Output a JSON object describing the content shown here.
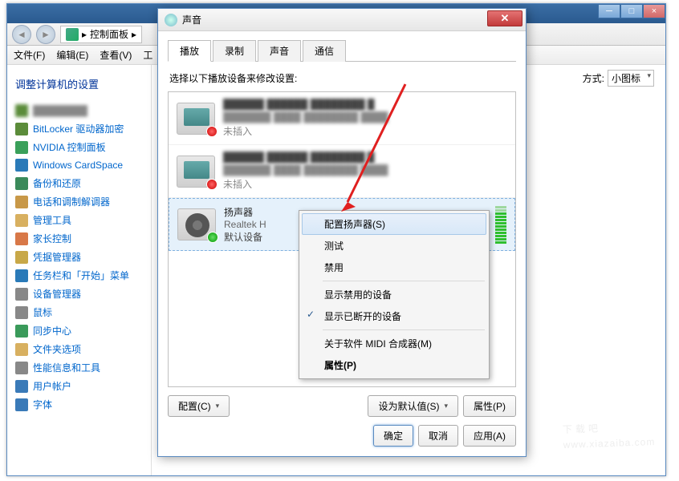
{
  "bg": {
    "path_label": "控制面板",
    "menu": [
      "文件(F)",
      "编辑(E)",
      "查看(V)",
      "工"
    ],
    "heading": "调整计算机的设置",
    "view_label": "方式:",
    "view_value": "小图标",
    "items": [
      {
        "label": "BitLocker 驱动器加密",
        "color": "#5b8c3a"
      },
      {
        "label": "NVIDIA 控制面板",
        "color": "#3aa05a"
      },
      {
        "label": "Windows CardSpace",
        "color": "#2a7ab8"
      },
      {
        "label": "备份和还原",
        "color": "#3a8a5a"
      },
      {
        "label": "电话和调制解调器",
        "color": "#c89848"
      },
      {
        "label": "管理工具",
        "color": "#d8b060"
      },
      {
        "label": "家长控制",
        "color": "#d87848"
      },
      {
        "label": "凭据管理器",
        "color": "#c8a848"
      },
      {
        "label": "任务栏和「开始」菜单",
        "color": "#2a7ab8"
      },
      {
        "label": "设备管理器",
        "color": "#888888"
      },
      {
        "label": "鼠标",
        "color": "#888888"
      },
      {
        "label": "同步中心",
        "color": "#3a9a5a"
      },
      {
        "label": "文件夹选项",
        "color": "#d8b060"
      },
      {
        "label": "性能信息和工具",
        "color": "#888888"
      },
      {
        "label": "用户帐户",
        "color": "#3a7ab8"
      },
      {
        "label": "字体",
        "color": "#3a7ab8"
      }
    ]
  },
  "dlg": {
    "title": "声音",
    "tabs": [
      "播放",
      "录制",
      "声音",
      "通信"
    ],
    "instruction": "选择以下播放设备来修改设置:",
    "dev_unplugged": "未插入",
    "dev3": {
      "name": "扬声器",
      "driver": "Realtek H",
      "default": "默认设备"
    },
    "btn_configure": "配置(C)",
    "btn_setdefault": "设为默认值(S)",
    "btn_properties": "属性(P)",
    "btn_ok": "确定",
    "btn_cancel": "取消",
    "btn_apply": "应用(A)"
  },
  "ctx": {
    "configure_speakers": "配置扬声器(S)",
    "test": "测试",
    "disable": "禁用",
    "show_disabled": "显示禁用的设备",
    "show_disconnected": "显示已断开的设备",
    "about_midi": "关于软件 MIDI 合成器(M)",
    "properties": "属性(P)"
  },
  "watermark": {
    "big": "下载吧",
    "small": "www.xiazaiba.com"
  }
}
